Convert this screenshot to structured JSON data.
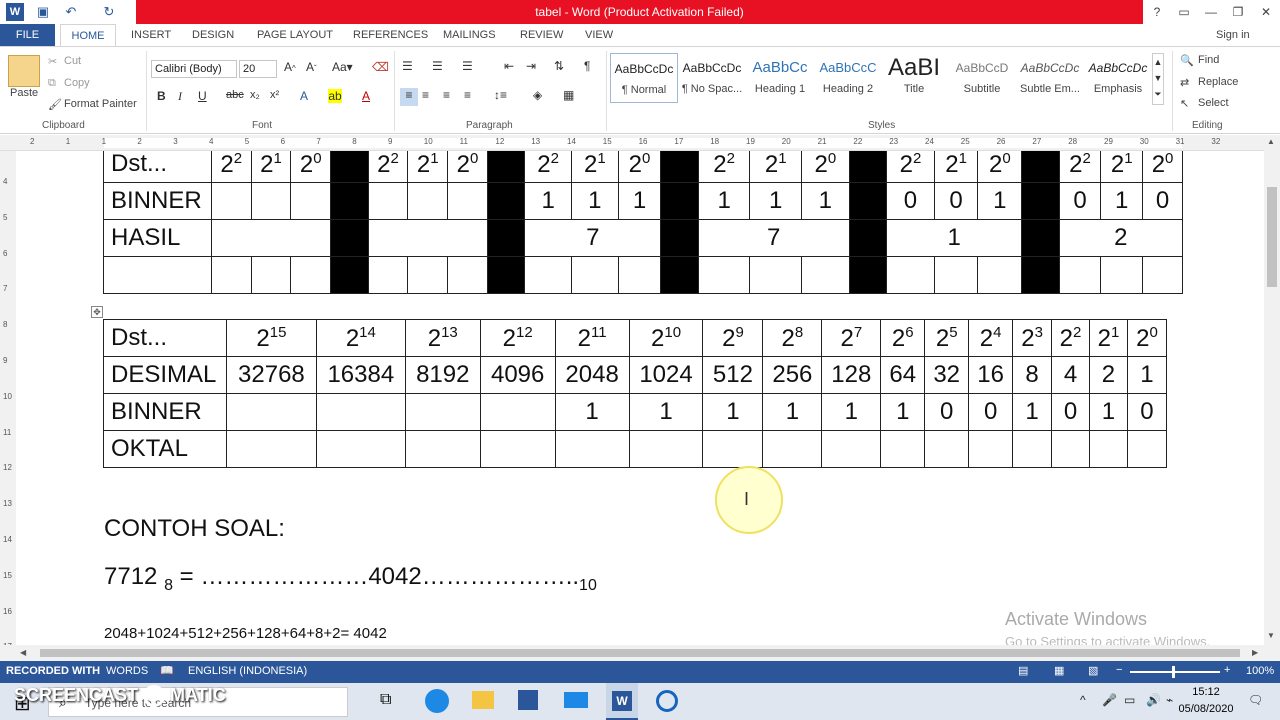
{
  "window": {
    "title": "tabel -  Word (Product Activation Failed)",
    "help": "?",
    "sign_in": "Sign in"
  },
  "tabs": [
    "FILE",
    "HOME",
    "INSERT",
    "DESIGN",
    "PAGE LAYOUT",
    "REFERENCES",
    "MAILINGS",
    "REVIEW",
    "VIEW"
  ],
  "ribbon": {
    "clipboard": {
      "paste": "Paste",
      "cut": "Cut",
      "copy": "Copy",
      "format_painter": "Format Painter",
      "label": "Clipboard"
    },
    "font": {
      "name": "Calibri (Body)",
      "size": "20",
      "label": "Font"
    },
    "paragraph": {
      "label": "Paragraph"
    },
    "styles": {
      "label": "Styles",
      "items": [
        {
          "preview": "AaBbCcDc",
          "name": "¶ Normal"
        },
        {
          "preview": "AaBbCcDc",
          "name": "¶ No Spac..."
        },
        {
          "preview": "AaBbCc",
          "name": "Heading 1"
        },
        {
          "preview": "AaBbCcC",
          "name": "Heading 2"
        },
        {
          "preview": "AaBI",
          "name": "Title"
        },
        {
          "preview": "AaBbCcD",
          "name": "Subtitle"
        },
        {
          "preview": "AaBbCcDc",
          "name": "Subtle Em..."
        },
        {
          "preview": "AaBbCcDc",
          "name": "Emphasis"
        }
      ]
    },
    "editing": {
      "find": "Find",
      "replace": "Replace",
      "select": "Select",
      "label": "Editing"
    }
  },
  "ruler": {
    "h": [
      "2",
      "1",
      "1",
      "2",
      "3",
      "4",
      "5",
      "6",
      "7",
      "8",
      "9",
      "10",
      "11",
      "12",
      "13",
      "14",
      "15",
      "16",
      "17",
      "18",
      "19",
      "20",
      "21",
      "22",
      "23",
      "24",
      "25",
      "26",
      "27",
      "28",
      "29",
      "30",
      "31",
      "32"
    ],
    "v": [
      "4",
      "5",
      "6",
      "7",
      "8",
      "9",
      "10",
      "11",
      "12",
      "13",
      "14",
      "15",
      "16",
      "17"
    ]
  },
  "table1": {
    "header": [
      "Dst...",
      "2",
      "2",
      "2",
      "",
      "2",
      "2",
      "2",
      "",
      "2",
      "2",
      "2",
      "",
      "2",
      "2",
      "2",
      "",
      "2",
      "2",
      "2",
      "",
      "2",
      "2",
      "2"
    ],
    "header_sup": [
      "",
      "2",
      "1",
      "0",
      "",
      "2",
      "1",
      "0",
      "",
      "2",
      "1",
      "0",
      "",
      "2",
      "1",
      "0",
      "",
      "2",
      "1",
      "0",
      "",
      "2",
      "1",
      "0"
    ],
    "binner_label": "BINNER",
    "binner": [
      "",
      "",
      "",
      "",
      "",
      "",
      "",
      "",
      "1",
      "1",
      "1",
      "",
      "1",
      "1",
      "1",
      "",
      "0",
      "0",
      "1",
      "",
      "0",
      "1",
      "0"
    ],
    "hasil_label": "HASIL",
    "hasil": [
      "",
      "",
      "7",
      "7",
      "1",
      "2"
    ]
  },
  "table2": {
    "header_label": "Dst...",
    "powers": [
      "15",
      "14",
      "13",
      "12",
      "11",
      "10",
      "9",
      "8",
      "7",
      "6",
      "5",
      "4",
      "3",
      "2",
      "1",
      "0"
    ],
    "desimal_label": "DESIMAL",
    "desimal": [
      "32768",
      "16384",
      "8192",
      "4096",
      "2048",
      "1024",
      "512",
      "256",
      "128",
      "64",
      "32",
      "16",
      "8",
      "4",
      "2",
      "1"
    ],
    "binner_label": "BINNER",
    "binner": [
      "",
      "",
      "",
      "",
      "1",
      "1",
      "1",
      "1",
      "1",
      "1",
      "0",
      "0",
      "1",
      "0",
      "1",
      "0"
    ],
    "oktal_label": "OKTAL"
  },
  "content": {
    "heading": "CONTOH SOAL:",
    "eq_left": "7712 ",
    "eq_sub": "8",
    "eq_mid": " = …………………4042………………..",
    "eq_sub2": "10",
    "sum": "2048+1024+512+256+128+64+8+2= 4042"
  },
  "watermark": {
    "line1": "Activate Windows",
    "line2": "Go to Settings to activate Windows."
  },
  "status": {
    "recorded": "RECORDED WITH",
    "words": "WORDS",
    "language": "ENGLISH (INDONESIA)",
    "zoom": "100%"
  },
  "taskbar": {
    "search": "Type here to search",
    "time": "15:12",
    "date": "05/08/2020",
    "screencast": "SCREENCAST",
    "matic": "MATIC"
  }
}
